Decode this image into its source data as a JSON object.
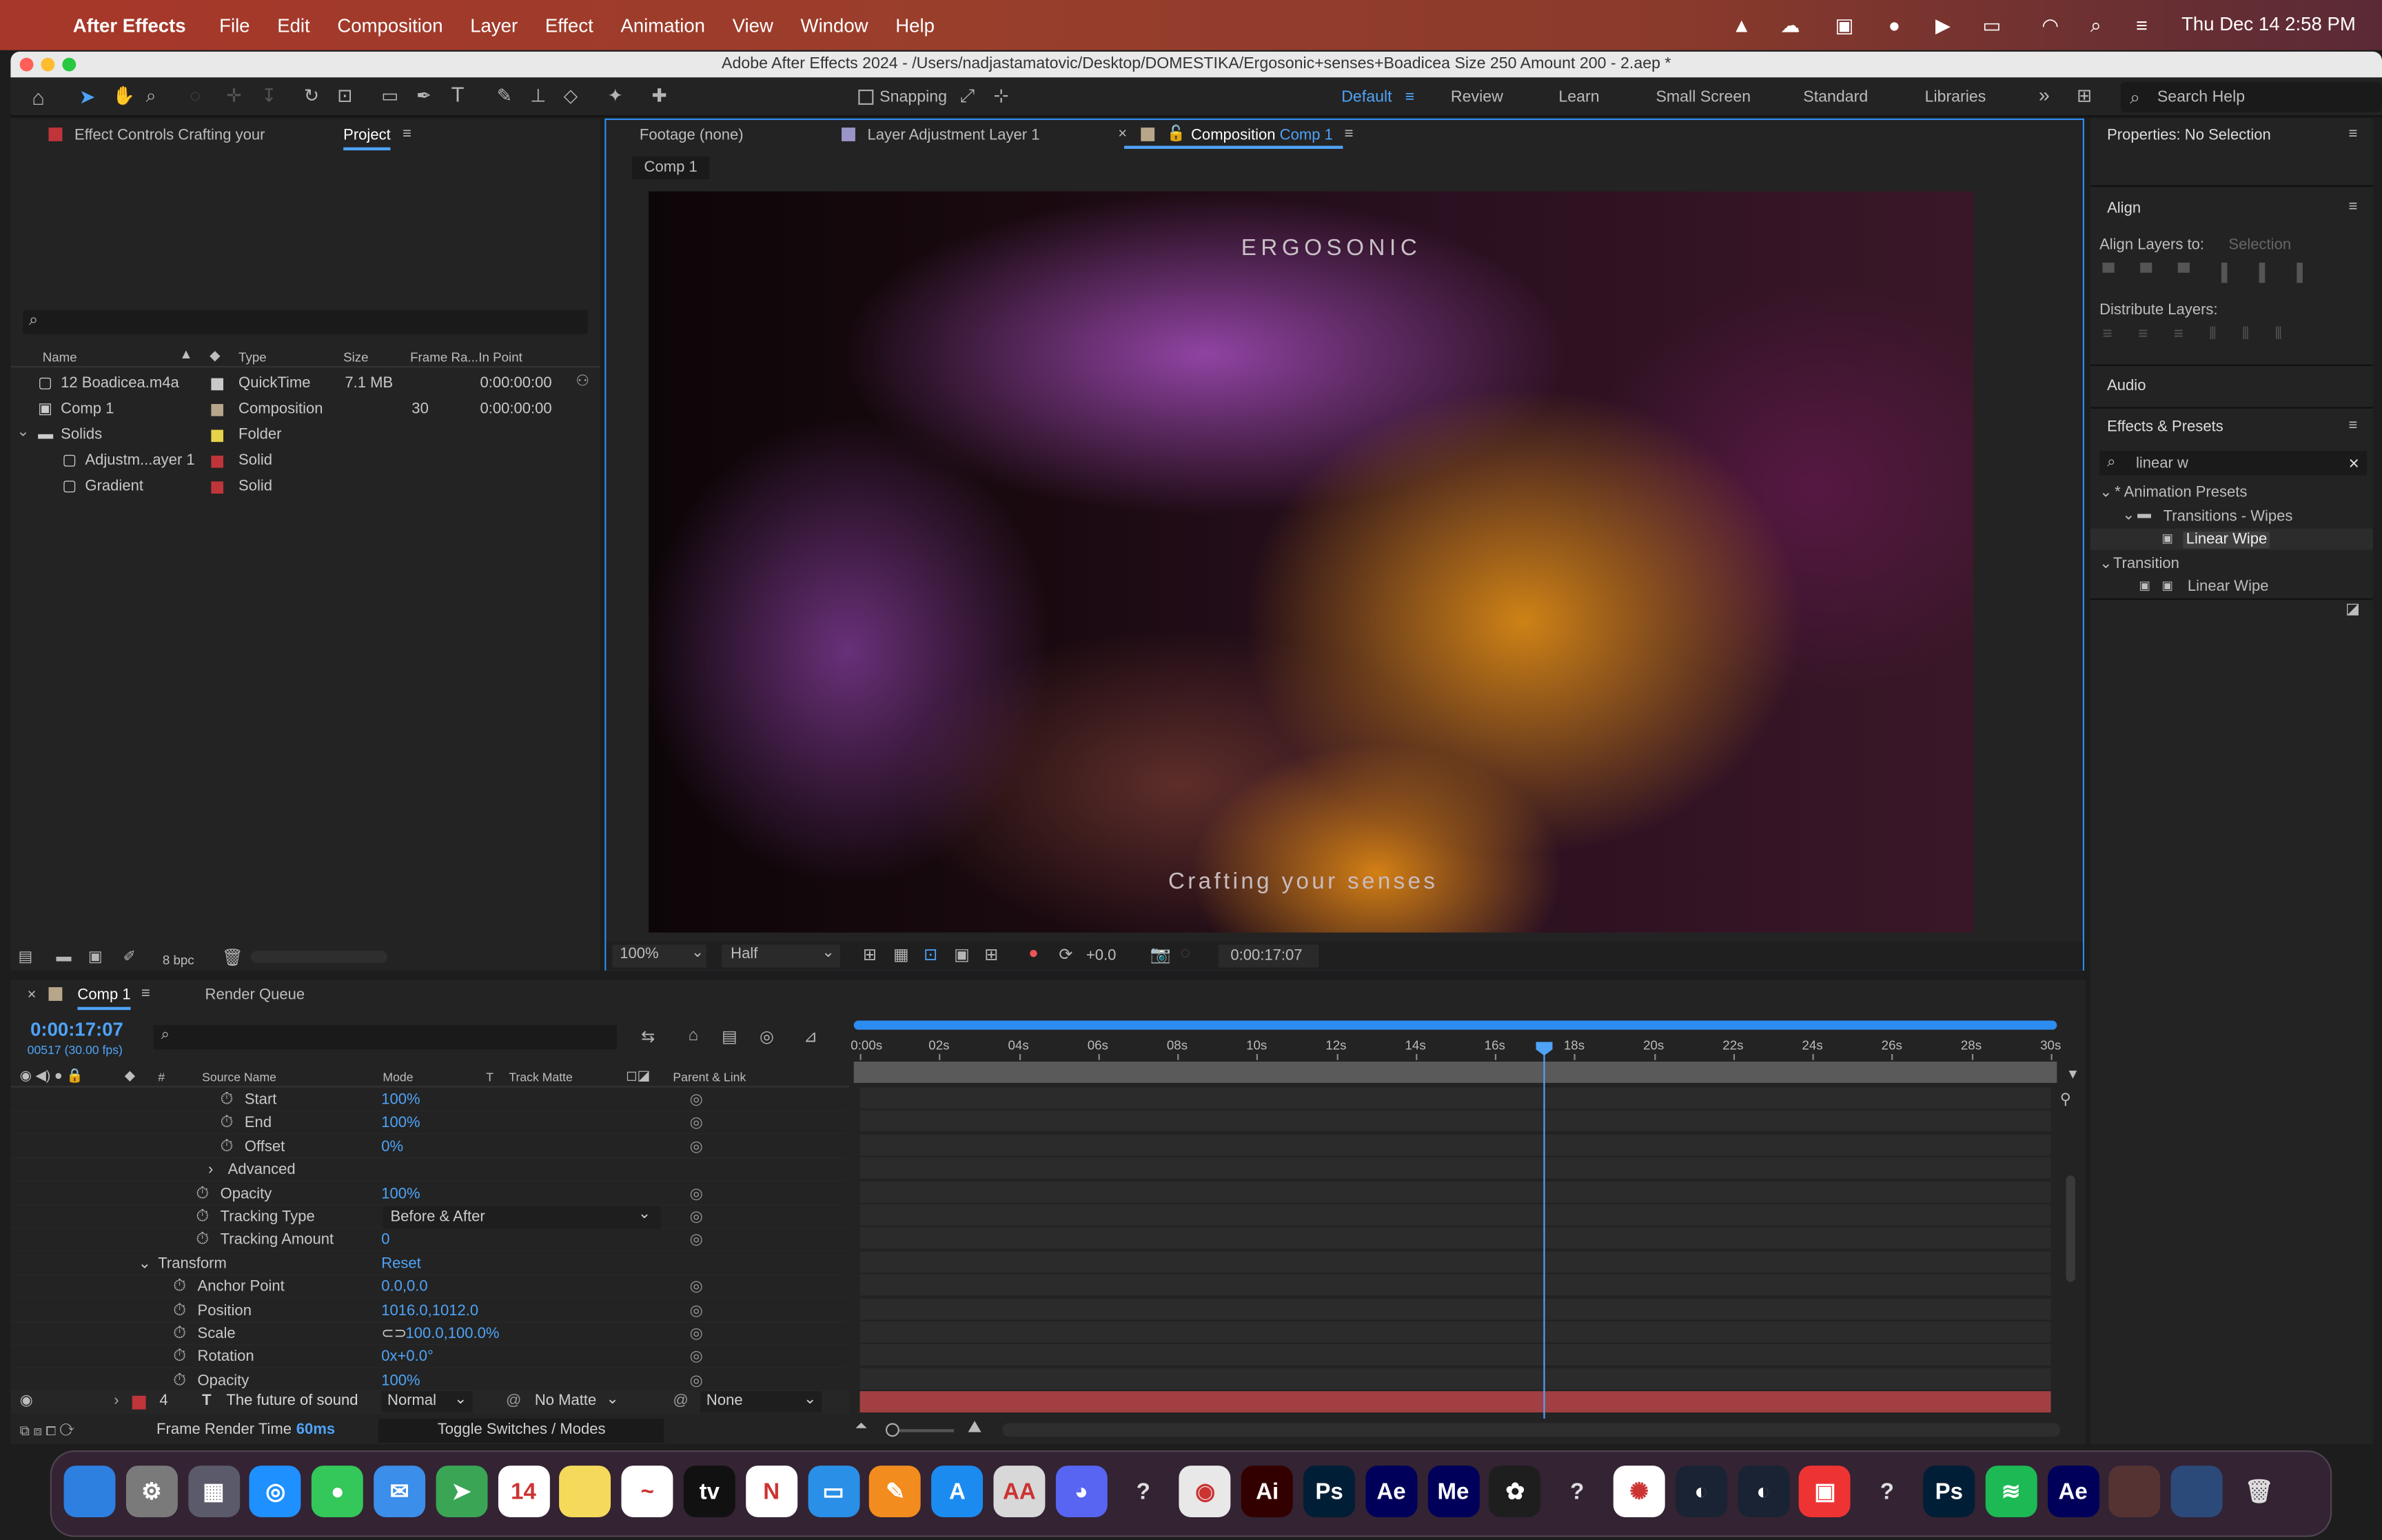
{
  "menubar": {
    "app": "After Effects",
    "items": [
      "File",
      "Edit",
      "Composition",
      "Layer",
      "Effect",
      "Animation",
      "View",
      "Window",
      "Help"
    ],
    "datetime": "Thu Dec 14  2:58 PM"
  },
  "window": {
    "title": "Adobe After Effects 2024 - /Users/nadjastamatovic/Desktop/DOMESTIKA/Ergosonic+senses+Boadicea Size 250 Amount 200 - 2.aep *"
  },
  "toolbar": {
    "snapping": "Snapping",
    "workspaces": [
      "Default",
      "Review",
      "Learn",
      "Small Screen",
      "Standard",
      "Libraries"
    ],
    "search_help": "Search Help"
  },
  "left_panel": {
    "tab_effect_controls": "Effect Controls Crafting your",
    "tab_project": "Project",
    "search_placeholder": "",
    "columns": [
      "Name",
      "Type",
      "Size",
      "Frame Ra...",
      "In Point"
    ],
    "items": [
      {
        "name": "12 Boadicea.m4a",
        "type": "QuickTime",
        "size": "7.1 MB",
        "frame_rate": "",
        "in_point": "0:00:00:00",
        "color": "#c9c9c9"
      },
      {
        "name": "Comp 1",
        "type": "Composition",
        "size": "",
        "frame_rate": "30",
        "in_point": "0:00:00:00",
        "color": "#b8a68a"
      },
      {
        "name": "Solids",
        "type": "Folder",
        "size": "",
        "frame_rate": "",
        "in_point": "",
        "color": "#e6d34a"
      },
      {
        "name": "Adjustm...ayer 1",
        "type": "Solid",
        "size": "",
        "frame_rate": "",
        "in_point": "",
        "color": "#c0353a"
      },
      {
        "name": "Gradient",
        "type": "Solid",
        "size": "",
        "frame_rate": "",
        "in_point": "",
        "color": "#c0353a"
      }
    ],
    "bpc": "8 bpc"
  },
  "viewer": {
    "tab_footage": "Footage (none)",
    "tab_layer": "Layer Adjustment Layer 1",
    "tab_comp_prefix": "Composition",
    "tab_comp_name": "Comp 1",
    "sub_tab": "Comp 1",
    "title_text": "ERGOSONIC",
    "subtitle_text": "Crafting your senses",
    "zoom": "100%",
    "resolution": "Half",
    "exposure": "+0.0",
    "timecode": "0:00:17:07"
  },
  "right_panel": {
    "properties": "Properties: No Selection",
    "align": "Align",
    "align_layers_to": "Align Layers to:",
    "align_selection": "Selection",
    "distribute": "Distribute Layers:",
    "audio": "Audio",
    "effects": "Effects & Presets",
    "search_value": "linear w",
    "tree": [
      "* Animation Presets",
      "Transitions - Wipes",
      "Linear Wipe",
      "Transition",
      "Linear Wipe"
    ]
  },
  "timeline": {
    "tab": "Comp 1",
    "render_queue": "Render Queue",
    "timecode": "0:00:17:07",
    "frames": "00517 (30.00 fps)",
    "columns": {
      "source": "Source Name",
      "mode": "Mode",
      "t": "T",
      "track_matte": "Track Matte",
      "parent": "Parent & Link",
      "num": "#"
    },
    "props": [
      {
        "name": "Start",
        "value": "100%",
        "indent": 142
      },
      {
        "name": "End",
        "value": "100%",
        "indent": 142
      },
      {
        "name": "Offset",
        "value": "0%",
        "indent": 142
      },
      {
        "name": "Advanced",
        "value": "",
        "indent": 143
      },
      {
        "name": "Opacity",
        "value": "100%",
        "indent": 126
      },
      {
        "name": "Tracking Type",
        "value": "Before & After",
        "indent": 126
      },
      {
        "name": "Tracking Amount",
        "value": "0",
        "indent": 126
      },
      {
        "name": "Transform",
        "value": "Reset",
        "indent": 97
      },
      {
        "name": "Anchor Point",
        "value": "0.0,0.0",
        "indent": 111
      },
      {
        "name": "Position",
        "value": "1016.0,1012.0",
        "indent": 111
      },
      {
        "name": "Scale",
        "value": "100.0,100.0%",
        "indent": 111
      },
      {
        "name": "Rotation",
        "value": "0x+0.0°",
        "indent": 111
      },
      {
        "name": "Opacity",
        "value": "100%",
        "indent": 111
      }
    ],
    "layer": {
      "num": "4",
      "name": "The future of sound",
      "mode": "Normal",
      "matte": "No Matte",
      "parent": "None"
    },
    "ticks": [
      "0:00s",
      "02s",
      "04s",
      "06s",
      "08s",
      "10s",
      "12s",
      "14s",
      "16s",
      "18s",
      "20s",
      "22s",
      "24s",
      "26s",
      "28s",
      "30s"
    ],
    "frame_render": "Frame Render Time",
    "frame_render_value": "60ms",
    "toggle": "Toggle Switches / Modes"
  },
  "dock": {
    "items": [
      {
        "name": "finder-icon",
        "label": "",
        "bg": "#2d7fe0"
      },
      {
        "name": "system-settings-icon",
        "label": "⚙",
        "bg": "#7a7a7a"
      },
      {
        "name": "launchpad-icon",
        "label": "▦",
        "bg": "#5a5a6a"
      },
      {
        "name": "safari-icon",
        "label": "◎",
        "bg": "#1e90ff"
      },
      {
        "name": "messages-icon",
        "label": "●",
        "bg": "#34c759"
      },
      {
        "name": "mail-icon",
        "label": "✉",
        "bg": "#3b8eea"
      },
      {
        "name": "maps-icon",
        "label": "➤",
        "bg": "#3aa655"
      },
      {
        "name": "calendar-icon",
        "label": "14",
        "bg": "#ffffff"
      },
      {
        "name": "notes-icon",
        "label": "",
        "bg": "#f5d95b"
      },
      {
        "name": "freeform-icon",
        "label": "~",
        "bg": "#ffffff"
      },
      {
        "name": "apple-tv-icon",
        "label": "tv",
        "bg": "#111111"
      },
      {
        "name": "news-icon",
        "label": "N",
        "bg": "#ffffff"
      },
      {
        "name": "keynote-icon",
        "label": "▭",
        "bg": "#2a8fe6"
      },
      {
        "name": "pages-icon",
        "label": "✎",
        "bg": "#f28c1e"
      },
      {
        "name": "app-store-icon",
        "label": "A",
        "bg": "#1c8bf0"
      },
      {
        "name": "font-book-icon",
        "label": "AA",
        "bg": "#d8d8d8"
      },
      {
        "name": "discord-icon",
        "label": "◕",
        "bg": "#5865f2"
      },
      {
        "name": "unknown-app-icon",
        "label": "?",
        "bg": "transparent"
      },
      {
        "name": "chrome-icon",
        "label": "◉",
        "bg": "#e8e8e8"
      },
      {
        "name": "illustrator-icon",
        "label": "Ai",
        "bg": "#330000"
      },
      {
        "name": "photoshop-icon",
        "label": "Ps",
        "bg": "#001e36"
      },
      {
        "name": "after-effects-icon",
        "label": "Ae",
        "bg": "#00005b"
      },
      {
        "name": "media-encoder-icon",
        "label": "Me",
        "bg": "#00005b"
      },
      {
        "name": "figma-icon",
        "label": "✿",
        "bg": "#1e1e1e"
      },
      {
        "name": "unknown-app-icon-2",
        "label": "?",
        "bg": "transparent"
      },
      {
        "name": "photos-icon",
        "label": "✺",
        "bg": "#ffffff"
      },
      {
        "name": "cinema4d-icon",
        "label": "◐",
        "bg": "#1a2333"
      },
      {
        "name": "cinema4d-icon-2",
        "label": "◐",
        "bg": "#1a2333"
      },
      {
        "name": "app-icon",
        "label": "▣",
        "bg": "#e33"
      },
      {
        "name": "unknown-app-icon-3",
        "label": "?",
        "bg": "transparent"
      },
      {
        "name": "photoshop-icon-2",
        "label": "Ps",
        "bg": "#001e36"
      },
      {
        "name": "spotify-icon",
        "label": "≋",
        "bg": "#1db954"
      },
      {
        "name": "after-effects-icon-2",
        "label": "Ae",
        "bg": "#00005b"
      },
      {
        "name": "minimized-window-1",
        "label": "",
        "bg": "#553333"
      },
      {
        "name": "minimized-window-2",
        "label": "",
        "bg": "#2b4a7a"
      },
      {
        "name": "trash-icon",
        "label": "🗑",
        "bg": "transparent"
      }
    ]
  }
}
